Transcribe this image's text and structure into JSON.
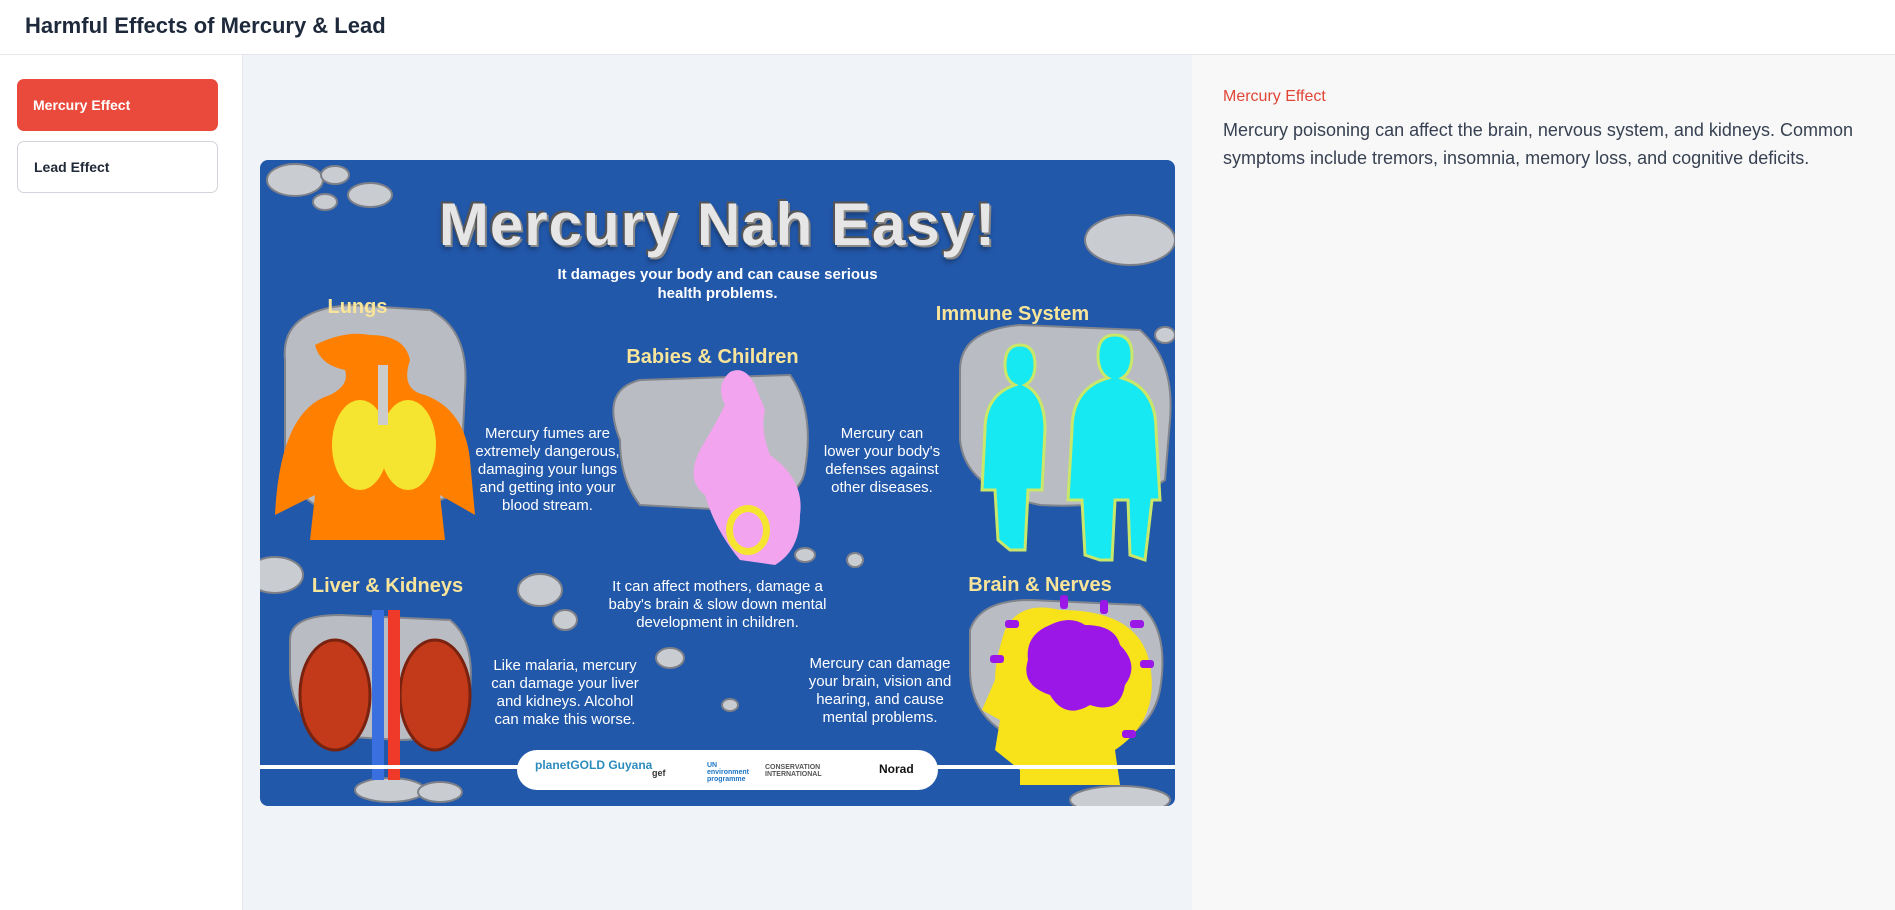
{
  "app": {
    "title": "Harmful Effects of Mercury & Lead"
  },
  "sidebar": {
    "items": [
      {
        "label": "Mercury Effect",
        "active": true
      },
      {
        "label": "Lead Effect",
        "active": false
      }
    ]
  },
  "detail": {
    "label": "Mercury Effect",
    "text": "Mercury poisoning can affect the brain, nervous system, and kidneys. Common symptoms include tremors, insomnia, memory loss, and cognitive deficits."
  },
  "poster": {
    "title": "Mercury Nah Easy!",
    "subtitle": "It damages your body and can cause serious health problems.",
    "sections": {
      "lungs": {
        "heading": "Lungs",
        "text": "Mercury fumes are extremely dangerous, damaging your lungs and getting into your blood stream."
      },
      "babies": {
        "heading": "Babies & Children",
        "text": "It can affect mothers, damage a baby's brain & slow down mental development in children."
      },
      "immune": {
        "heading": "Immune System",
        "text": "Mercury can lower your body's defenses against other diseases."
      },
      "liver": {
        "heading": "Liver & Kidneys",
        "text": "Like malaria, mercury can damage your liver and kidneys. Alcohol can make this worse."
      },
      "brain": {
        "heading": "Brain & Nerves",
        "text": "Mercury can damage your brain, vision and hearing, and cause mental problems."
      }
    },
    "logos": [
      "planetGOLD Guyana",
      "gef",
      "UN environment programme",
      "CONSERVATION INTERNATIONAL",
      "Norad"
    ]
  },
  "colors": {
    "accent": "#ea4a3c",
    "poster_bg": "#2258aa",
    "heading_yellow": "#f8e59a"
  }
}
